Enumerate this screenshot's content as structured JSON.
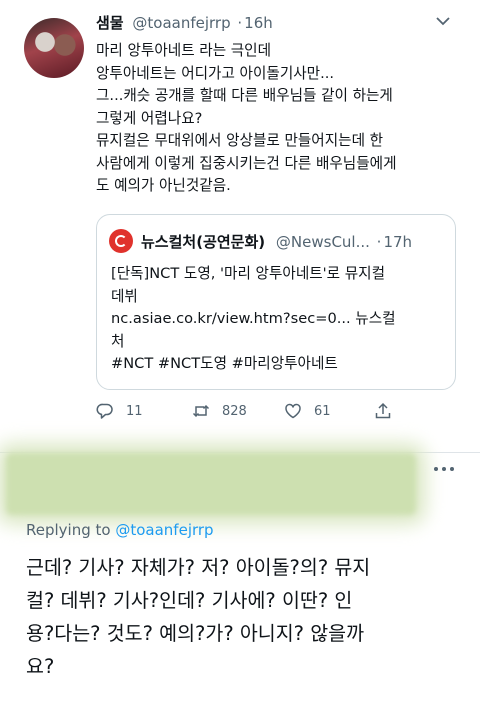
{
  "tweet": {
    "author_name": "샘물",
    "handle": "@toaanfejrrp",
    "time": "16h",
    "separator": "·",
    "body_lines": [
      "마리 앙투아네트 라는 극인데",
      "앙투아네트는 어디가고 아이돌기사만...",
      "그...캐슷 공개를 할때 다른 배우님들 같이 하는게",
      "그렇게 어렵나요?",
      "뮤지컬은 무대위에서 앙상블로 만들어지는데 한",
      "사람에게 이렇게 집중시키는건 다른 배우님들에게",
      "도 예의가 아닌것같음."
    ],
    "quote": {
      "author_name": "뉴스컬처(공연문화)",
      "handle": "@NewsCul...",
      "time": "17h",
      "separator": "·",
      "body_lines": [
        "[단독]NCT 도영, '마리 앙투아네트'로 뮤지컬",
        "데뷔",
        "nc.asiae.co.kr/view.htm?sec=0... 뉴스컬",
        "처",
        "#NCT #NCT도영 #마리앙투아네트"
      ]
    },
    "actions": {
      "reply_count": "11",
      "retweet_count": "828",
      "like_count": "61",
      "reply_icon": "reply-icon",
      "retweet_icon": "retweet-icon",
      "like_icon": "heart-icon",
      "share_icon": "share-icon"
    }
  },
  "reply": {
    "replying_label": "Replying to",
    "replying_handle": "@toaanfejrrp",
    "body_lines": [
      "근데? 기사? 자체가? 저? 아이돌?의? 뮤지",
      "컬? 데뷔? 기사?인데? 기사에? 이딴? 인",
      "용?다는? 것도? 예의?가? 아니지? 않을까",
      "요?"
    ]
  },
  "colors": {
    "text": "#0f1419",
    "secondary": "#536471",
    "link": "#1d9bf0",
    "border": "#cfd9de",
    "blur_highlight": "#cde0b0",
    "news_logo": "#e0322c"
  }
}
